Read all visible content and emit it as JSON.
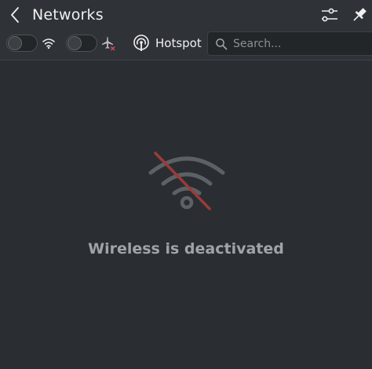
{
  "header": {
    "back_icon": "chevron-left-icon",
    "title": "Networks",
    "configure_icon": "configure-sliders-icon",
    "pin_icon": "pin-icon"
  },
  "toolbar": {
    "wifi_toggle": {
      "checked": false,
      "icon": "wifi-icon"
    },
    "airplane_toggle": {
      "checked": false,
      "icon": "airplane-mode-icon"
    },
    "hotspot_label": "Hotspot",
    "hotspot_icon": "hotspot-icon",
    "search": {
      "placeholder": "Search...",
      "value": "",
      "icon": "search-icon"
    }
  },
  "main": {
    "status_icon": "wireless-disabled-icon",
    "status_message": "Wireless is deactivated"
  },
  "colors": {
    "background": "#2a2e32",
    "header_background": "#2f3338",
    "text": "#eff0f1",
    "muted_text": "#a0a4a8",
    "disabled_slash": "#9b3a3a"
  }
}
